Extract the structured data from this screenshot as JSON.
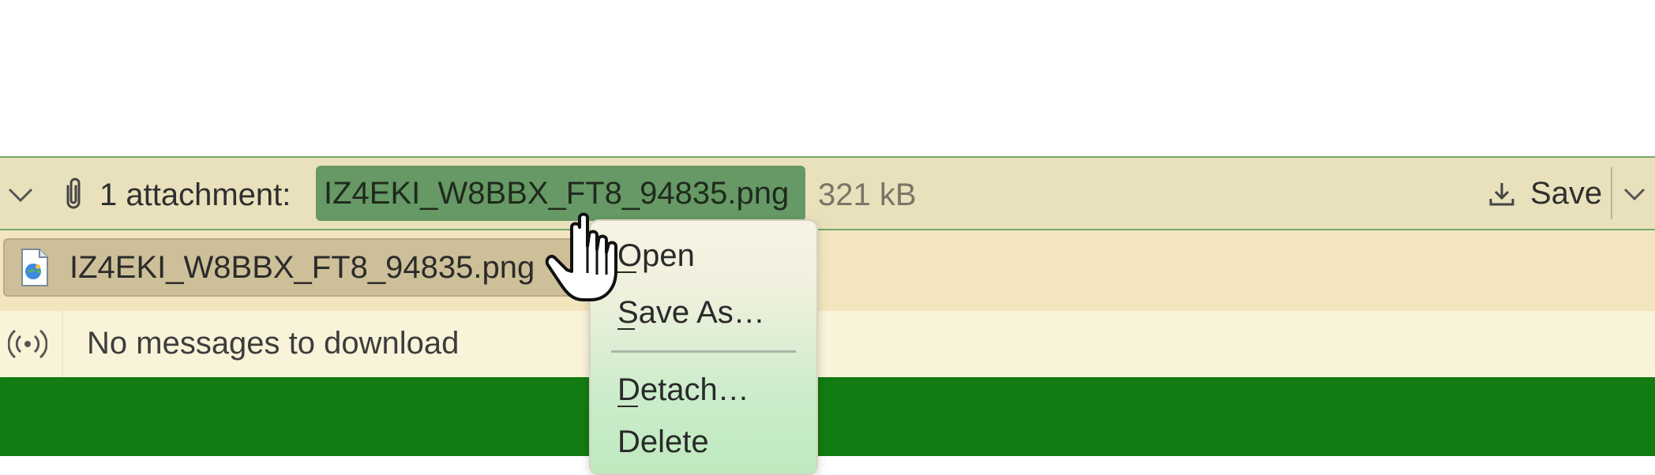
{
  "attachment_bar": {
    "count_label": "1 attachment:",
    "file_name": "IZ4EKI_W8BBX_FT8_94835.png",
    "file_size": "321 kB",
    "save_label": "Save",
    "toggle_icon": "chevron-down-icon",
    "clip_icon": "paperclip-icon",
    "save_icon": "download-icon"
  },
  "attachment_list": {
    "items": [
      {
        "name": "IZ4EKI_W8BBX_FT8_94835.png",
        "icon": "image-file-icon"
      }
    ]
  },
  "status": {
    "text": "No messages to download",
    "icon": "signal-icon"
  },
  "context_menu": {
    "items": [
      {
        "label": "Open",
        "accesskey": "O"
      },
      {
        "label": "Save As…",
        "accesskey": "S"
      },
      {
        "label": "Detach…",
        "accesskey": "D"
      },
      {
        "label": "Delete",
        "accesskey": ""
      }
    ]
  },
  "colors": {
    "attachment_bar_bg": "#e9e1bc",
    "highlight": "#669965",
    "list_bg": "#f3e6bf",
    "status_bg": "#f9f3d9",
    "window_green": "#127c12"
  }
}
